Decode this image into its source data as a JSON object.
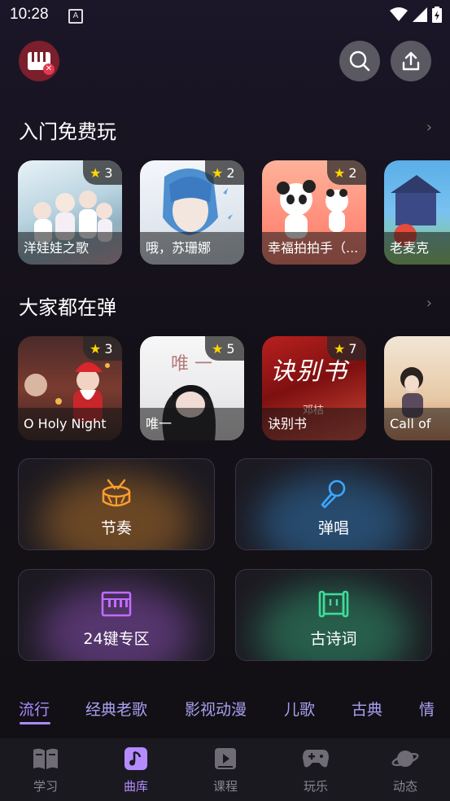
{
  "status_bar": {
    "time": "10:28",
    "notification_letter": "A"
  },
  "colors": {
    "accent": "#a98cff",
    "star": "#ffd600",
    "drum": "#ff9d2e",
    "mic": "#3da8ff",
    "keyboard": "#c26bff",
    "poetry": "#3ddc9a"
  },
  "header": {
    "app_logo": "piano-logo-icon",
    "search_icon": "search-icon",
    "share_icon": "share-icon"
  },
  "sections": [
    {
      "title": "入门免费玩",
      "more": "›",
      "items": [
        {
          "title": "洋娃娃之歌",
          "rating": "3"
        },
        {
          "title": "哦，苏珊娜",
          "rating": "2"
        },
        {
          "title": "幸福拍拍手（...",
          "rating": "2"
        },
        {
          "title": "老麦克",
          "rating": ""
        }
      ]
    },
    {
      "title": "大家都在弹",
      "more": "›",
      "items": [
        {
          "title": "O Holy Night",
          "rating": "3"
        },
        {
          "title": "唯一",
          "rating": "5",
          "art_text": "唯 一"
        },
        {
          "title": "诀别书",
          "rating": "7",
          "art_text": "诀别书",
          "art_sub": "邓桔"
        },
        {
          "title": "Call of",
          "rating": ""
        }
      ]
    }
  ],
  "tiles": [
    {
      "label": "节奏",
      "icon": "drum-icon"
    },
    {
      "label": "弹唱",
      "icon": "microphone-icon"
    },
    {
      "label": "24键专区",
      "icon": "keyboard-icon"
    },
    {
      "label": "古诗词",
      "icon": "scroll-icon"
    }
  ],
  "genre_tabs": [
    "流行",
    "经典老歌",
    "影视动漫",
    "儿歌",
    "古典",
    "情"
  ],
  "active_genre": "流行",
  "bottom_nav": [
    {
      "label": "学习",
      "icon": "book-icon"
    },
    {
      "label": "曲库",
      "icon": "music-note-icon"
    },
    {
      "label": "课程",
      "icon": "video-course-icon"
    },
    {
      "label": "玩乐",
      "icon": "gamepad-icon"
    },
    {
      "label": "动态",
      "icon": "planet-icon"
    }
  ],
  "active_nav": "曲库"
}
